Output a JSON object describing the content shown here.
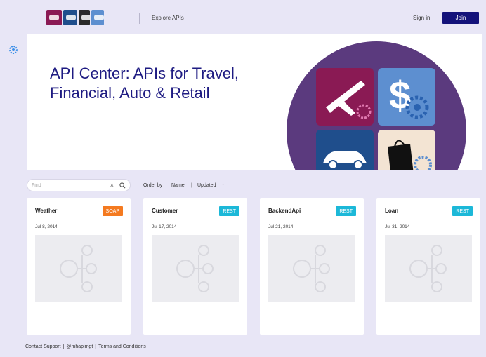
{
  "header": {
    "nav_link": "Explore APIs",
    "sign_in": "Sign in",
    "join": "Join"
  },
  "hero": {
    "title": "API Center: APIs for Travel, Financial, Auto & Retail"
  },
  "search": {
    "placeholder": "Find",
    "clear_glyph": "×"
  },
  "order": {
    "label": "Order by",
    "option_name": "Name",
    "separator": "|",
    "option_updated": "Updated",
    "arrow": "↑"
  },
  "cards": [
    {
      "name": "Weather",
      "badge": "SOAP",
      "badge_color": "#f47a20",
      "date": "Jul 8, 2014"
    },
    {
      "name": "Customer",
      "badge": "REST",
      "badge_color": "#1cb8d8",
      "date": "Jul 17, 2014"
    },
    {
      "name": "BackendApi",
      "badge": "REST",
      "badge_color": "#1cb8d8",
      "date": "Jul 21, 2014"
    },
    {
      "name": "Loan",
      "badge": "REST",
      "badge_color": "#1cb8d8",
      "date": "Jul 31, 2014"
    }
  ],
  "footer": {
    "contact": "Contact Support",
    "sep1": "|",
    "handle": "@mhapimgt",
    "sep2": "|",
    "terms": "Terms and Conditions"
  },
  "colors": {
    "background": "#e8e6f6",
    "accent": "#13127a",
    "hero_circle": "#5b3a7e"
  }
}
